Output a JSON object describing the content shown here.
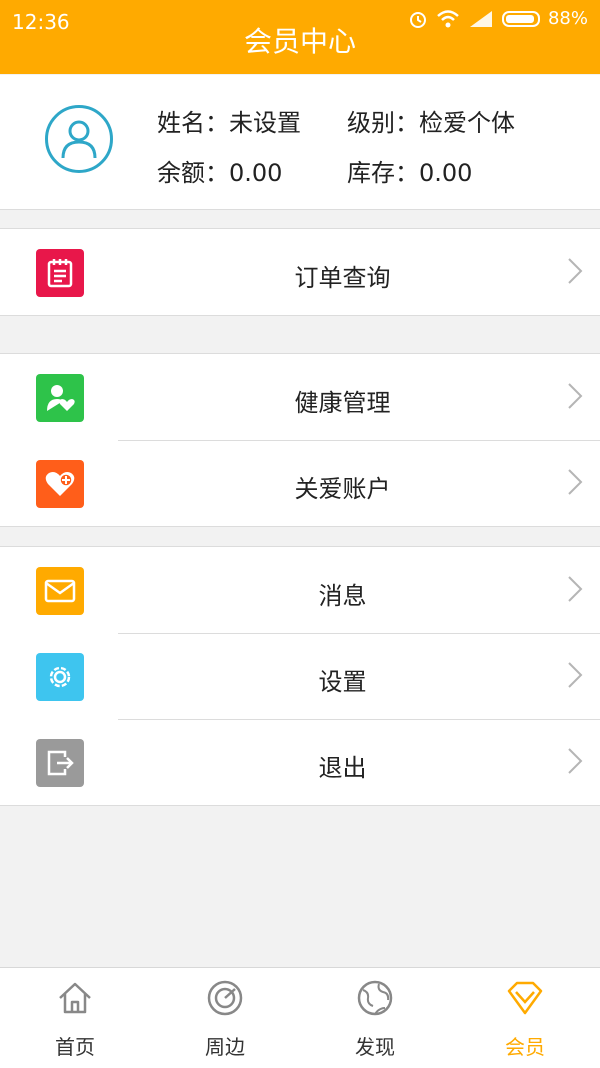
{
  "status": {
    "time": "12:36",
    "battery": "88%"
  },
  "header": {
    "title": "会员中心"
  },
  "profile": {
    "name_label": "姓名：未设置",
    "level_label": "级别：检爱个体",
    "balance_label": "余额：0.00",
    "stock_label": "库存：0.00"
  },
  "menu": {
    "order": "订单查询",
    "health": "健康管理",
    "care": "关爱账户",
    "message": "消息",
    "settings": "设置",
    "logout": "退出"
  },
  "tabs": [
    {
      "label": "首页",
      "icon": "home-icon"
    },
    {
      "label": "周边",
      "icon": "radar-icon"
    },
    {
      "label": "发现",
      "icon": "globe-icon"
    },
    {
      "label": "会员",
      "icon": "diamond-icon"
    }
  ],
  "colors": {
    "accent": "#ffaa00",
    "order_icon": "#e8174a",
    "health_icon": "#2ec34a",
    "care_icon": "#ff5e1a",
    "message_icon": "#ffaa00",
    "settings_icon": "#3ec5ef",
    "logout_icon": "#9a9a9a"
  }
}
